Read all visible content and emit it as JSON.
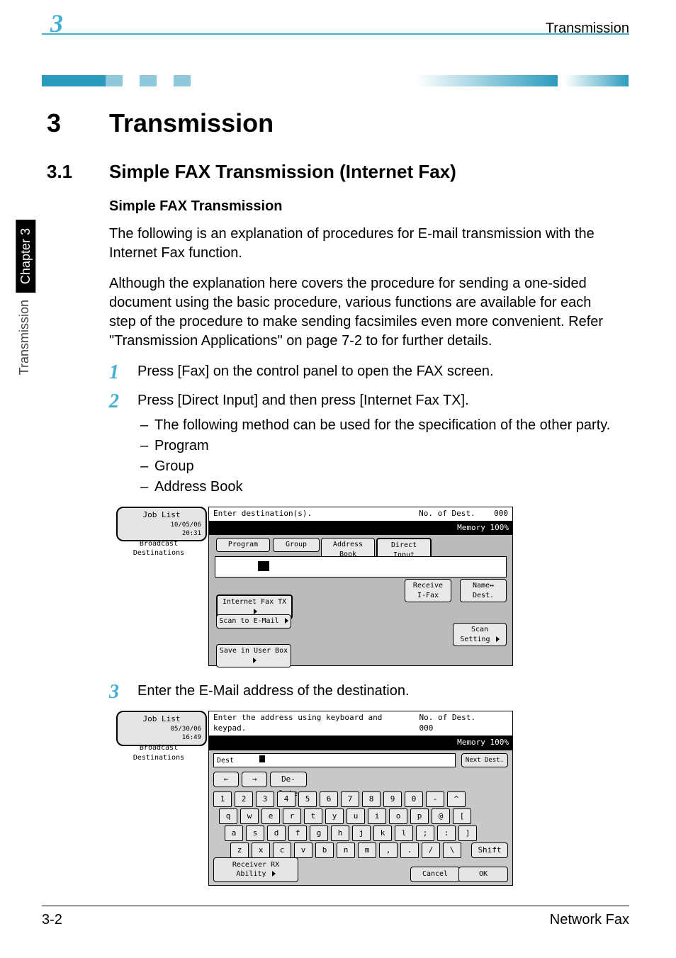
{
  "header": {
    "chapter_tab_number": "3",
    "section_title_right": "Transmission"
  },
  "side_tab": {
    "chapter": "Chapter 3",
    "label": "Transmission"
  },
  "title": {
    "number": "3",
    "text": "Transmission"
  },
  "section": {
    "number": "3.1",
    "text": "Simple FAX Transmission (Internet Fax)"
  },
  "sub_heading": "Simple FAX Transmission",
  "paragraphs": {
    "p1": "The following is an explanation of procedures for E-mail transmission with the Internet Fax function.",
    "p2": "Although the explanation here covers the procedure for sending a one-sided document using the basic procedure, various functions are available for each step of the procedure to make sending facsimiles even more convenient. Refer \"Transmission Applications\" on page 7-2 to for further details."
  },
  "steps": {
    "s1": {
      "n": "1",
      "text": "Press [Fax] on the control panel to open the FAX screen."
    },
    "s2": {
      "n": "2",
      "text": "Press [Direct Input] and then press [Internet Fax TX].",
      "bullets": [
        "The following method can be used for the specification of the other party.",
        "Program",
        "Group",
        "Address Book"
      ]
    },
    "s3": {
      "n": "3",
      "text": "Enter the E-Mail address of the destination."
    }
  },
  "lcd1": {
    "job_list": "Job List",
    "date": "10/05/06",
    "time": "20:31",
    "top_status": "Enter destination(s).",
    "no_of": "No. of Dest.",
    "no_val": "000",
    "memory": "Memory 100%",
    "side_button": "Broadcast Destinations",
    "tabs": {
      "program": "Program",
      "group": "Group",
      "address_book": "Address Book",
      "direct_input": "Direct Input"
    },
    "receive": "Receive I-Fax",
    "name_dest": "Name↔ Dest.",
    "ifax": "Internet Fax TX",
    "scan_email": "Scan to E-Mail",
    "save_box": "Save in User Box",
    "scan_setting": "Scan Setting"
  },
  "lcd2": {
    "job_list": "Job List",
    "date": "05/30/06",
    "time": "16:49",
    "top_status": "Enter the address using keyboard and keypad.",
    "no_of": "No. of Dest.",
    "no_val": "000",
    "memory": "Memory 100%",
    "side_button": "Broadcast Destinations",
    "dest_label": "Dest",
    "next_dest": "Next Dest.",
    "delete": "De- lete",
    "shift": "Shift",
    "receiver": "Receiver RX Ability",
    "cancel": "Cancel",
    "ok": "OK",
    "arrows": {
      "left": "←",
      "right": "→"
    },
    "rows": [
      [
        "1",
        "2",
        "3",
        "4",
        "5",
        "6",
        "7",
        "8",
        "9",
        "0",
        "-",
        "^"
      ],
      [
        "q",
        "w",
        "e",
        "r",
        "t",
        "y",
        "u",
        "i",
        "o",
        "p",
        "@",
        "["
      ],
      [
        "a",
        "s",
        "d",
        "f",
        "g",
        "h",
        "j",
        "k",
        "l",
        ";",
        ":",
        "]"
      ],
      [
        "z",
        "x",
        "c",
        "v",
        "b",
        "n",
        "m",
        ",",
        ".",
        "/",
        "\\"
      ]
    ]
  },
  "footer": {
    "left": "3-2",
    "right": "Network Fax"
  }
}
